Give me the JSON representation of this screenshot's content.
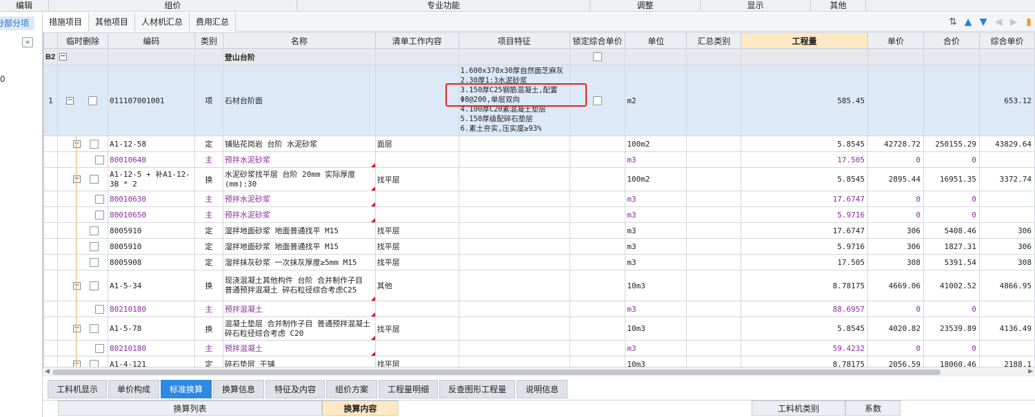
{
  "menubar": [
    "编辑",
    "组价",
    "专业功能",
    "调整",
    "显示",
    "其他"
  ],
  "left_pane": {
    "tab_label": "分部分项",
    "mark": "0"
  },
  "tabs": [
    "措施项目",
    "其他项目",
    "人材机汇总",
    "费用汇总"
  ],
  "columns": [
    "",
    "临时删除",
    "编码",
    "类别",
    "名称",
    "清单工作内容",
    "项目特征",
    "锁定综合单价",
    "单位",
    "汇总类别",
    "工程量",
    "单价",
    "合价",
    "综合单价"
  ],
  "section": {
    "id": "B2",
    "name": "登山台阶"
  },
  "main_item": {
    "rownum": "1",
    "code": "011107001001",
    "type": "项",
    "name": "石材台阶面",
    "features": [
      "1.600x370x30厚自然面芝麻灰",
      "2.30厚1:3水泥砂浆",
      "3.150厚C25钢筋混凝土,配置",
      "Φ8@200,单层双向",
      "4.100厚C20素混凝土垫层",
      "5.150厚级配碎石垫层",
      "6.素土夯实,压实度≥93%"
    ],
    "unit": "m2",
    "qty": "585.45",
    "zhdj": "653.12"
  },
  "rows": [
    {
      "code": "A1-12-58",
      "type": "定",
      "name": "铺贴花岗岩 台阶 水泥砂浆",
      "work": "面层",
      "unit": "100m2",
      "qty": "5.8545",
      "price": "42728.72",
      "total": "250155.29",
      "zh": "43829.64",
      "kind": "quota",
      "pm": true
    },
    {
      "code": "80010640",
      "type": "主",
      "name": "预拌水泥砂浆",
      "work": "",
      "unit": "m3",
      "qty": "17.505",
      "price": "0",
      "total": "0",
      "zh": "",
      "kind": "main"
    },
    {
      "code": "A1-12-5 + 补A1-12-3B * 2",
      "type": "换",
      "name": "水泥砂浆找平层 台阶 20mm  实际厚度(mm):30",
      "work": "找平层",
      "unit": "100m2",
      "qty": "5.8545",
      "price": "2895.44",
      "total": "16951.35",
      "zh": "3372.74",
      "kind": "quota2",
      "pm": true
    },
    {
      "code": "80010630",
      "type": "主",
      "name": "预拌水泥砂浆",
      "work": "",
      "unit": "m3",
      "qty": "17.6747",
      "price": "0",
      "total": "0",
      "zh": "",
      "kind": "main"
    },
    {
      "code": "80010650",
      "type": "主",
      "name": "预拌水泥砂浆",
      "work": "",
      "unit": "m3",
      "qty": "5.9716",
      "price": "0",
      "total": "0",
      "zh": "",
      "kind": "main"
    },
    {
      "code": "8005910",
      "type": "定",
      "name": "湿拌地面砂浆 地面普通找平 M15",
      "work": "找平层",
      "unit": "m3",
      "qty": "17.6747",
      "price": "306",
      "total": "5408.46",
      "zh": "306",
      "kind": "quota"
    },
    {
      "code": "8005910",
      "type": "定",
      "name": "湿拌地面砂浆 地面普通找平 M15",
      "work": "找平层",
      "unit": "m3",
      "qty": "5.9716",
      "price": "306",
      "total": "1827.31",
      "zh": "306",
      "kind": "quota"
    },
    {
      "code": "8005908",
      "type": "定",
      "name": "湿拌抹灰砂浆 一次抹灰厚度≥5mm M15",
      "work": "找平层",
      "unit": "m3",
      "qty": "17.505",
      "price": "308",
      "total": "5391.54",
      "zh": "308",
      "kind": "quota"
    },
    {
      "code": "A1-5-34",
      "type": "换",
      "name": "现浇混凝土其他构件 台阶  合并制作子目 普通预拌混凝土 碎石粒径综合考虑C25",
      "work": "其他",
      "unit": "10m3",
      "qty": "8.78175",
      "price": "4669.06",
      "total": "41002.52",
      "zh": "4866.95",
      "kind": "quota3",
      "pm": true
    },
    {
      "code": "80210180",
      "type": "主",
      "name": "预拌混凝土",
      "work": "",
      "unit": "m3",
      "qty": "88.6957",
      "price": "0",
      "total": "0",
      "zh": "",
      "kind": "main"
    },
    {
      "code": "A1-5-78",
      "type": "换",
      "name": "混凝土垫层  合并制作子目 普通预拌混凝土 碎石粒径综合考虑 C20",
      "work": "找平层",
      "unit": "10m3",
      "qty": "5.8545",
      "price": "4020.82",
      "total": "23539.89",
      "zh": "4136.49",
      "kind": "quota2",
      "pm": true
    },
    {
      "code": "80210180",
      "type": "主",
      "name": "预拌混凝土",
      "work": "",
      "unit": "m3",
      "qty": "59.4232",
      "price": "0",
      "total": "0",
      "zh": "",
      "kind": "main"
    },
    {
      "code": "A1-4-121",
      "type": "定",
      "name": "碎石垫层 干铺",
      "work": "找平层",
      "unit": "10m3",
      "qty": "8.78175",
      "price": "2056.59",
      "total": "18060.46",
      "zh": "2188.1",
      "kind": "quota",
      "pm": true
    }
  ],
  "bottom_tabs": [
    "工料机显示",
    "单价构成",
    "标准换算",
    "换算信息",
    "特征及内容",
    "组价方案",
    "工程量明细",
    "反查图形工程量",
    "说明信息"
  ],
  "bottom_active": "标准换算",
  "bottom_headers": {
    "list": "换算列表",
    "content": "换算内容",
    "cat": "工料机类别",
    "coef": "系数"
  }
}
